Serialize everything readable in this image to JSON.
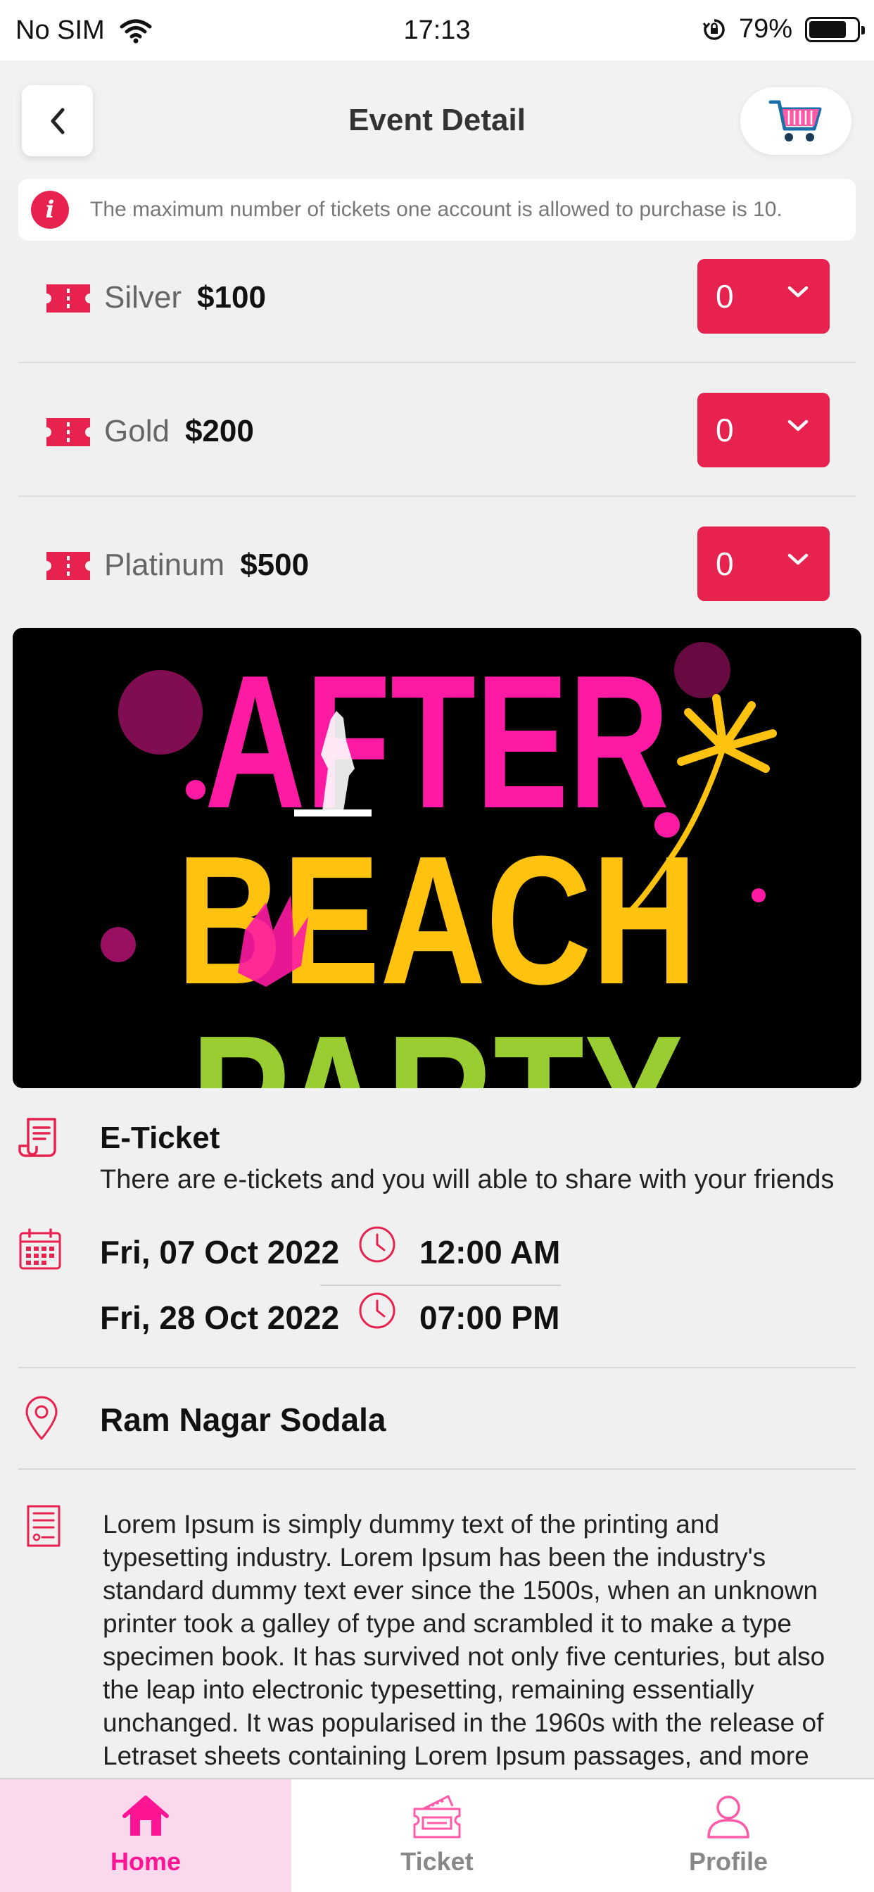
{
  "status_bar": {
    "carrier": "No SIM",
    "time": "17:13",
    "battery": "79%"
  },
  "header": {
    "title": "Event Detail"
  },
  "notice": {
    "text": "The maximum number of tickets one account is allowed to purchase is 10."
  },
  "tickets": [
    {
      "name": "Silver",
      "price": "$100",
      "qty": "0"
    },
    {
      "name": "Gold",
      "price": "$200",
      "qty": "0"
    },
    {
      "name": "Platinum",
      "price": "$500",
      "qty": "0"
    }
  ],
  "banner": {
    "line1": "AFTER",
    "line2": "BEACH",
    "line3": "PARTY"
  },
  "eticket": {
    "title": "E-Ticket",
    "description": "There are e-tickets and you will able to share with your friends"
  },
  "schedule": {
    "start_date": "Fri, 07 Oct 2022",
    "start_time": "12:00 AM",
    "end_date": "Fri, 28 Oct 2022",
    "end_time": "07:00 PM"
  },
  "location": "Ram Nagar Sodala",
  "description": "Lorem Ipsum is simply dummy text of the printing and typesetting industry. Lorem Ipsum has been the industry's standard dummy text ever since the 1500s, when an unknown printer took a galley of type and scrambled it to make a type specimen book. It has survived not only five centuries, but also the leap into electronic typesetting, remaining essentially unchanged. It was popularised in the 1960s with the release of Letraset sheets containing Lorem Ipsum passages, and more recently with desktop publishing software",
  "nav": {
    "home": "Home",
    "ticket": "Ticket",
    "profile": "Profile"
  },
  "colors": {
    "accent": "#e8224f",
    "pink": "#ff1493",
    "nav_active_bg": "#fbd9ec"
  }
}
